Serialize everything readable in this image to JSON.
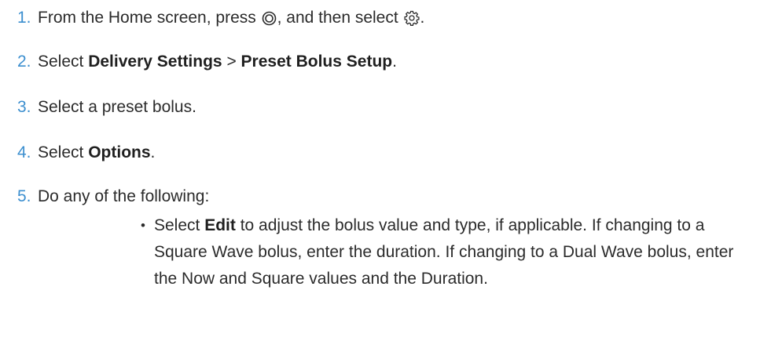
{
  "steps": [
    {
      "num": "1.",
      "text_a": "From the Home screen, press ",
      "icon_a": "select-button-icon",
      "text_b": ", and then select ",
      "icon_b": "gear-icon",
      "text_c": "."
    },
    {
      "num": "2.",
      "pre": "Select ",
      "bold1": "Delivery Settings",
      "sep": " > ",
      "bold2": "Preset Bolus Setup",
      "post": "."
    },
    {
      "num": "3.",
      "text": "Select a preset bolus."
    },
    {
      "num": "4.",
      "pre": "Select ",
      "bold": "Options",
      "post": "."
    },
    {
      "num": "5.",
      "text": "Do any of the following:"
    }
  ],
  "sub_items": [
    {
      "bullet": "•",
      "pre": "Select ",
      "bold": "Edit",
      "post": " to adjust the bolus value and type, if applicable. If changing to a Square Wave bolus, enter the duration. If changing to a Dual Wave bolus, enter the Now and Square values and the Duration."
    }
  ],
  "colors": {
    "number": "#3c8fcf",
    "text": "#2b2b2b"
  }
}
